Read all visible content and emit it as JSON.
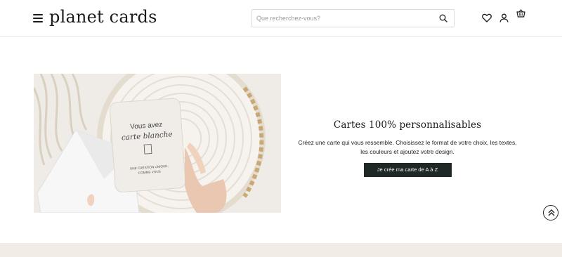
{
  "header": {
    "logo": "planet cards",
    "menu_icon": "hamburger-menu-icon",
    "search_placeholder": "Que recherchez-vous?",
    "icons": [
      "search-icon",
      "heart-icon",
      "user-icon",
      "basket-icon"
    ]
  },
  "hero": {
    "image_card_line1": "Vous avez",
    "image_card_line2": "carte blanche",
    "image_card_tagline": "UNE CRÉATION UNIQUE,",
    "image_card_tagline2": "COMME VOUS",
    "title": "Cartes 100% personnalisables",
    "text": "Créez une carte qui vous ressemble. Choisissez le format de votre choix, les textes, les couleurs et ajoutez votre design.",
    "cta": "Je crée ma carte de A à Z"
  },
  "scroll_top_icon": "double-chevron-up-icon",
  "colors": {
    "cta_bg": "#1f2727",
    "footer_band": "#f1ece6",
    "border": "#e6e6e6"
  }
}
